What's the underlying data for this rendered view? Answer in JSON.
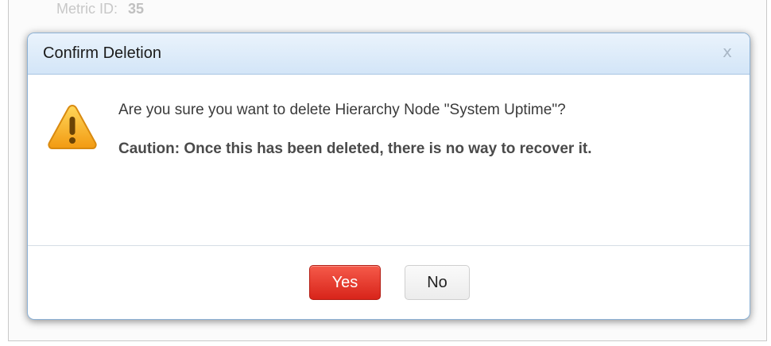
{
  "background": {
    "metric_label": "Metric ID:",
    "metric_value": "35"
  },
  "dialog": {
    "title": "Confirm Deletion",
    "close_label": "x",
    "question": "Are you sure you want to delete Hierarchy Node \"System Uptime\"?",
    "caution": "Caution: Once this has been deleted, there is no way to recover it.",
    "icon": "warning-icon",
    "buttons": {
      "yes_label": "Yes",
      "no_label": "No"
    }
  },
  "colors": {
    "header_bg": "#d3e5f7",
    "yes_button": "#e0352a",
    "warning_fill": "#f7b52c"
  }
}
